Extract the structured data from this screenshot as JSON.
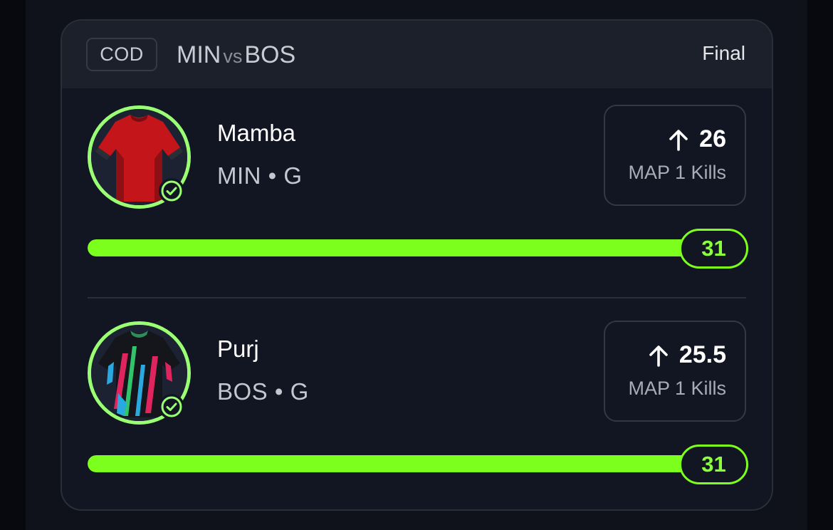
{
  "header": {
    "league": "COD",
    "home_team": "MIN",
    "vs_text": "vs",
    "away_team": "BOS",
    "status": "Final"
  },
  "players": [
    {
      "name": "Mamba",
      "meta": "MIN • G",
      "direction_icon": "arrow-up-icon",
      "line_value": "26",
      "stat_label": "MAP 1 Kills",
      "result": "31",
      "progress_fraction": 1.0,
      "jersey_color": "#c4151b",
      "status_icon": "check-circle-icon"
    },
    {
      "name": "Purj",
      "meta": "BOS • G",
      "direction_icon": "arrow-up-icon",
      "line_value": "25.5",
      "stat_label": "MAP 1 Kills",
      "result": "31",
      "progress_fraction": 1.0,
      "jersey_color": "#14161c",
      "status_icon": "check-circle-icon"
    }
  ],
  "colors": {
    "accent_green": "#7dff1e",
    "avatar_ring": "#9bff73",
    "card_bg": "#121622",
    "header_bg": "#1c202b"
  }
}
